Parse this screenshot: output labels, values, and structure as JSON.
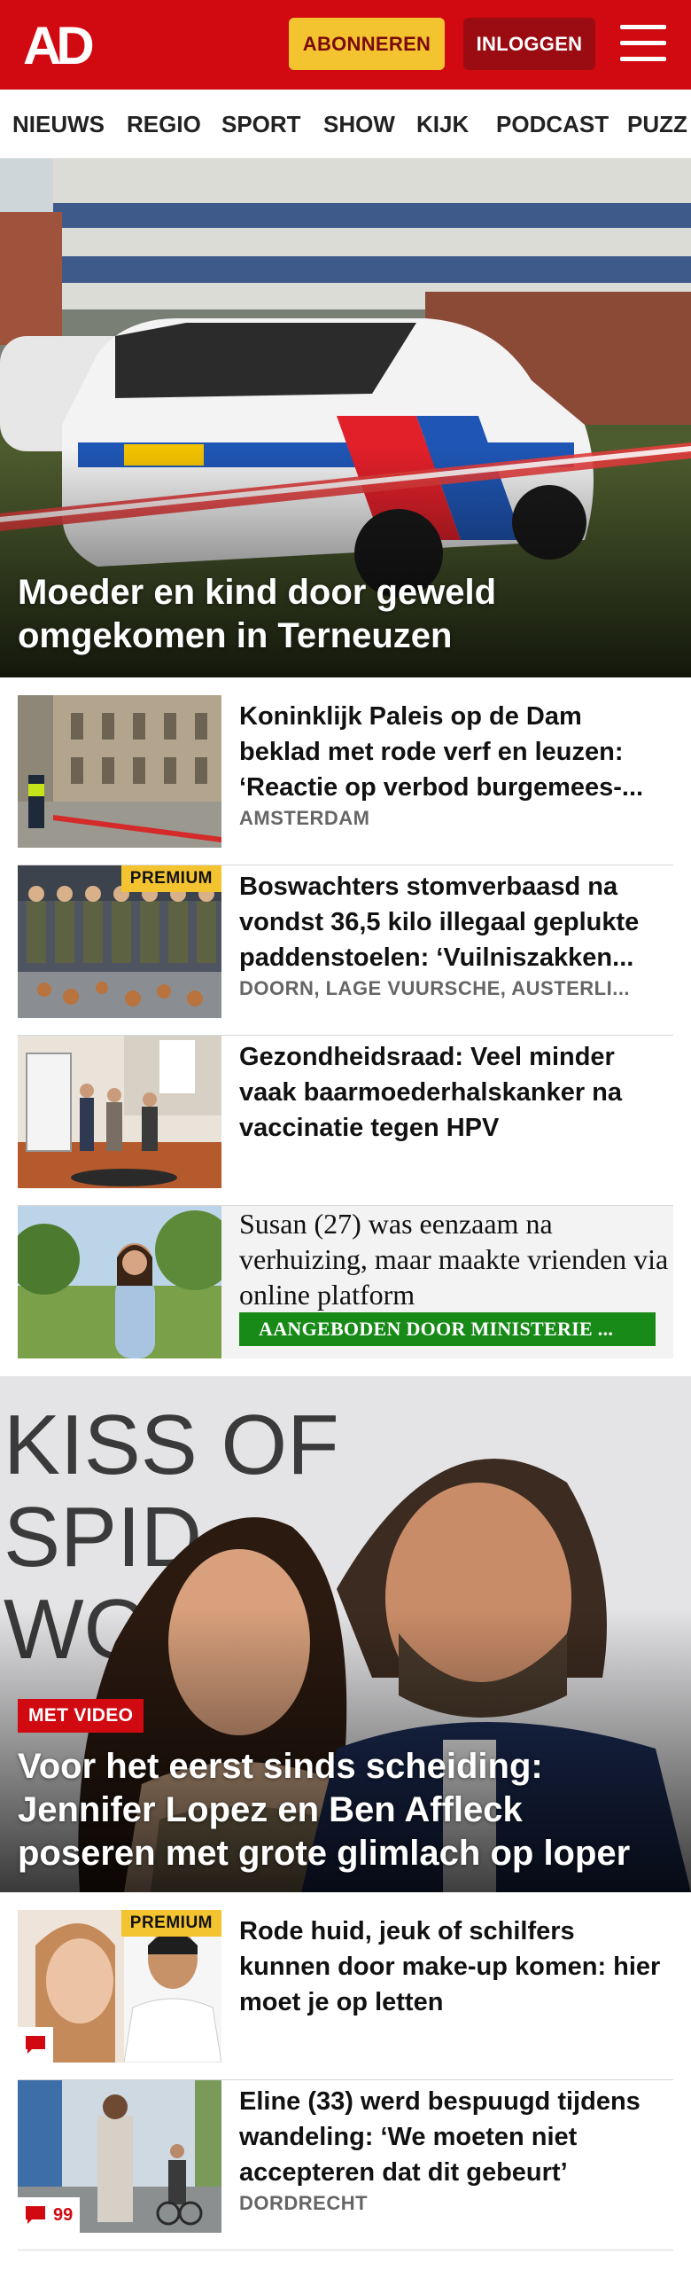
{
  "header": {
    "logo_text": "AD",
    "subscribe_label": "ABONNEREN",
    "login_label": "INLOGGEN",
    "brand_color": "#d10a11",
    "accent_color": "#f4c430",
    "menu_icon": "hamburger-menu-icon"
  },
  "nav": {
    "items": [
      "NIEUWS",
      "REGIO",
      "SPORT",
      "SHOW",
      "KIJK",
      "PODCAST",
      "PUZZ"
    ]
  },
  "hero1": {
    "title": "Moeder en kind door geweld omgekomen in Terneuzen"
  },
  "articles": [
    {
      "title": "Koninklijk Paleis op de Dam beklad met rode verf en leuzen: ‘Reactie op verbod burgemees-...",
      "tag": "AMSTERDAM"
    },
    {
      "premium": "PREMIUM",
      "title": "Boswachters stomverbaasd na vondst 36,5 kilo illegaal geplukte paddenstoelen: ‘Vuilniszakken...",
      "tag": "DOORN, LAGE VUURSCHE, AUSTERLI..."
    },
    {
      "title": "Gezondheidsraad: Veel minder vaak baarmoederhalskanker na vaccinatie tegen HPV"
    }
  ],
  "ad": {
    "title": "Susan (27) was eenzaam na verhuizing, maar maakte vrienden via online platform",
    "label": "AANGEBODEN DOOR MINISTERIE ..."
  },
  "hero2": {
    "badge": "MET VIDEO",
    "title": "Voor het eerst sinds scheiding: Jennifer Lopez en Ben Affleck poseren met grote glimlach op loper",
    "backdrop_text": [
      "KISS OF",
      "SPID",
      "WOM"
    ]
  },
  "articles2": [
    {
      "premium": "PREMIUM",
      "title": "Rode huid, jeuk of schilfers kunnen door make-up komen: hier moet je op letten",
      "comment_icon": "comment-bubble-icon"
    },
    {
      "title": "Eline (33) werd bespuugd tijdens wandeling: ‘We moeten niet accepteren dat dit gebeurt’",
      "tag": "DORDRECHT",
      "comment_count": "99",
      "comment_icon": "comment-bubble-icon"
    }
  ]
}
